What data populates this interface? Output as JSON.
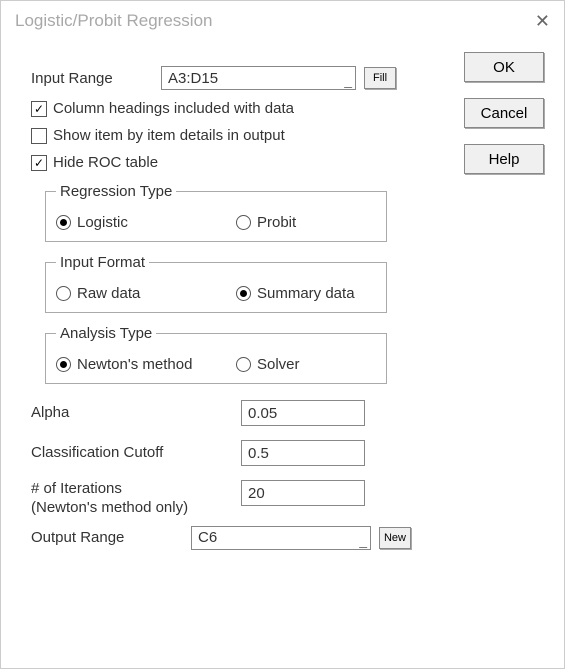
{
  "window_title": "Logistic/Probit Regression",
  "buttons": {
    "ok": "OK",
    "cancel": "Cancel",
    "help": "Help",
    "fill": "Fill",
    "new": "New"
  },
  "labels": {
    "input_range": "Input Range",
    "headings": "Column headings included with data",
    "details": "Show item by item details in output",
    "hide_roc": "Hide ROC table",
    "regression_type": "Regression Type",
    "logistic": "Logistic",
    "probit": "Probit",
    "input_format": "Input Format",
    "raw_data": "Raw data",
    "summary_data": "Summary data",
    "analysis_type": "Analysis Type",
    "newton": "Newton's method",
    "solver": "Solver",
    "alpha": "Alpha",
    "cutoff": "Classification Cutoff",
    "iterations": "# of Iterations\n(Newton's method only)",
    "output_range": "Output Range"
  },
  "values": {
    "input_range": "A3:D15",
    "alpha": "0.05",
    "cutoff": "0.5",
    "iterations": "20",
    "output_range": "C6"
  },
  "state": {
    "headings_checked": true,
    "details_checked": false,
    "hide_roc_checked": true,
    "regression": "logistic",
    "input_format": "summary",
    "analysis": "newton"
  }
}
